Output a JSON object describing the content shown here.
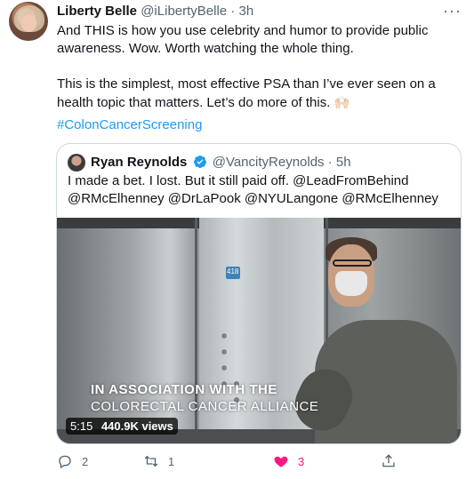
{
  "tweet": {
    "author_name": "Liberty Belle",
    "author_handle": "@iLibertyBelle",
    "separator": "·",
    "time": "3h",
    "more_label": "···",
    "text_line1": "And THIS is how you use celebrity and humor to provide public awareness. Wow. Worth watching the whole thing.",
    "text_line2": "This is the simplest, most effective PSA than I’ve ever seen on a health topic that matters. Let’s do more of this.",
    "emoji": "🙌🏻",
    "hashtag": "#ColonCancerScreening"
  },
  "quoted": {
    "author_name": "Ryan Reynolds",
    "author_handle": "@VancityReynolds",
    "separator": "·",
    "time": "5h",
    "text": "I made a bet. I lost. But it still paid off.  @LeadFromBehind @RMcElhenney @DrLaPook @NYULangone @RMcElhenney",
    "video": {
      "overlay_line1": "IN ASSOCIATION WITH THE",
      "overlay_line2": "COLORECTAL CANCER ALLIANCE",
      "duration": "5:15",
      "views": "440.9K views",
      "floor_indicator": "418"
    }
  },
  "actions": {
    "reply_count": "2",
    "retweet_count": "1",
    "like_count": "3"
  },
  "colors": {
    "link": "#1d9bf0",
    "like": "#f91880",
    "muted": "#536471"
  }
}
